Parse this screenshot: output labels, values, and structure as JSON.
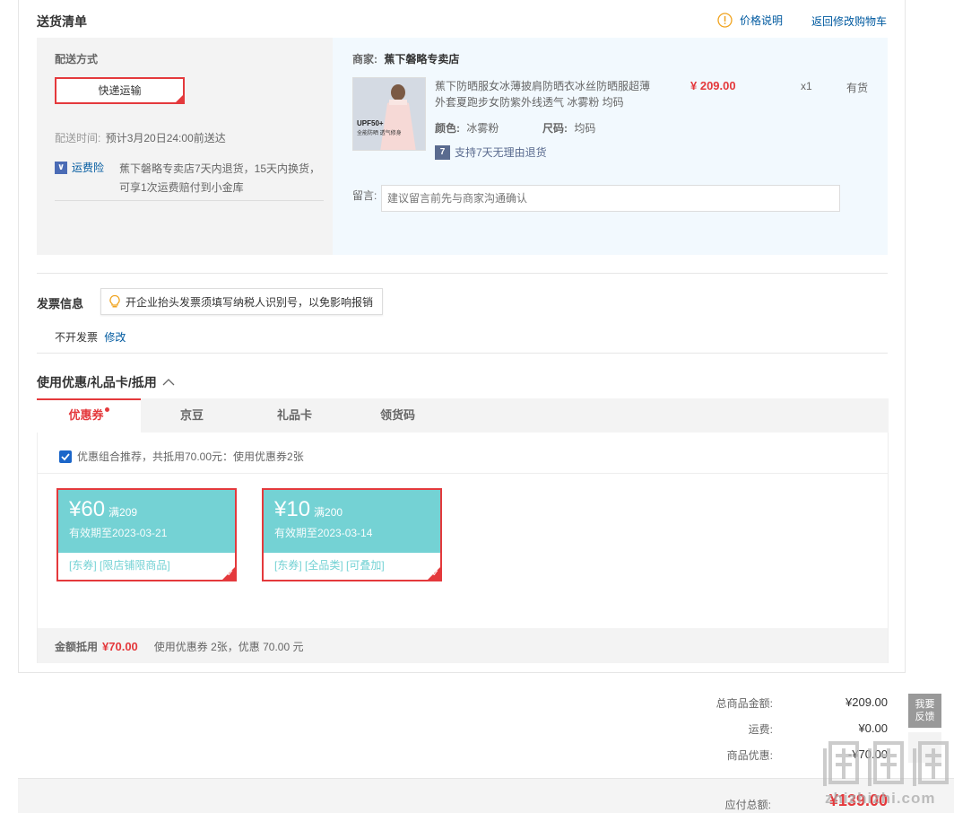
{
  "delivery": {
    "section_title": "送货清单",
    "price_note_label": "价格说明",
    "back_to_cart_label": "返回修改购物车",
    "method_title": "配送方式",
    "method_value": "快递运输",
    "time_label": "配送时间:",
    "time_value": "预计3月20日24:00前送达",
    "insurance_label": "运费险",
    "insurance_desc_line1": "蕉下磐略专卖店7天内退货，15天内换货，",
    "insurance_desc_line2": "可享1次运费赔付到小金库"
  },
  "shop": {
    "merchant_label": "商家:",
    "merchant_name": "蕉下磐略专卖店",
    "product_name_line1": "蕉下防晒服女冰薄披肩防晒衣冰丝防晒服超薄",
    "product_name_line2": "外套夏跑步女防紫外线透气 冰雾粉 均码",
    "price": "¥ 209.00",
    "qty": "x1",
    "stock": "有货",
    "color_label": "颜色:",
    "color_value": "冰雾粉",
    "size_label": "尺码:",
    "size_value": "均码",
    "return_badge": "7",
    "return_policy": "支持7天无理由退货",
    "thumb_text_1": "UPF50+",
    "thumb_text_2": "全能防晒 透气修身",
    "note_label": "留言:",
    "note_placeholder": "建议留言前先与商家沟通确认"
  },
  "invoice": {
    "title": "发票信息",
    "tip": "开企业抬头发票须填写纳税人识别号，以免影响报销",
    "status": "不开发票",
    "edit_label": "修改"
  },
  "discount": {
    "title": "使用优惠/礼品卡/抵用",
    "tabs": [
      "优惠券",
      "京豆",
      "礼品卡",
      "领货码"
    ],
    "recommend_text": "优惠组合推荐，共抵用70.00元：使用优惠券2张",
    "coupons": [
      {
        "amount": "¥60",
        "condition": "满209",
        "expiry": "有效期至2023-03-21",
        "tags": "[东券]  [限店铺限商品]"
      },
      {
        "amount": "¥10",
        "condition": "满200",
        "expiry": "有效期至2023-03-14",
        "tags": "[东券]  [全品类]  [可叠加]"
      }
    ],
    "footer_label": "金额抵用",
    "footer_amount": "¥70.00",
    "footer_desc": "使用优惠券 2张，优惠 70.00 元"
  },
  "summary": {
    "goods_total_label": "总商品金额:",
    "goods_total_value": "¥209.00",
    "shipping_label": "运费:",
    "shipping_value": "¥0.00",
    "promo_label": "商品优惠:",
    "promo_value": "-¥70.00",
    "payable_label": "应付总额:",
    "payable_value": "¥139.00"
  },
  "feedback": {
    "line1": "我要",
    "line2": "反馈"
  },
  "watermark": {
    "site": "zhizhizhi.com"
  },
  "colors": {
    "accent_red": "#e4393c",
    "link_blue": "#005aa0",
    "coupon_teal": "#74d2d4"
  }
}
